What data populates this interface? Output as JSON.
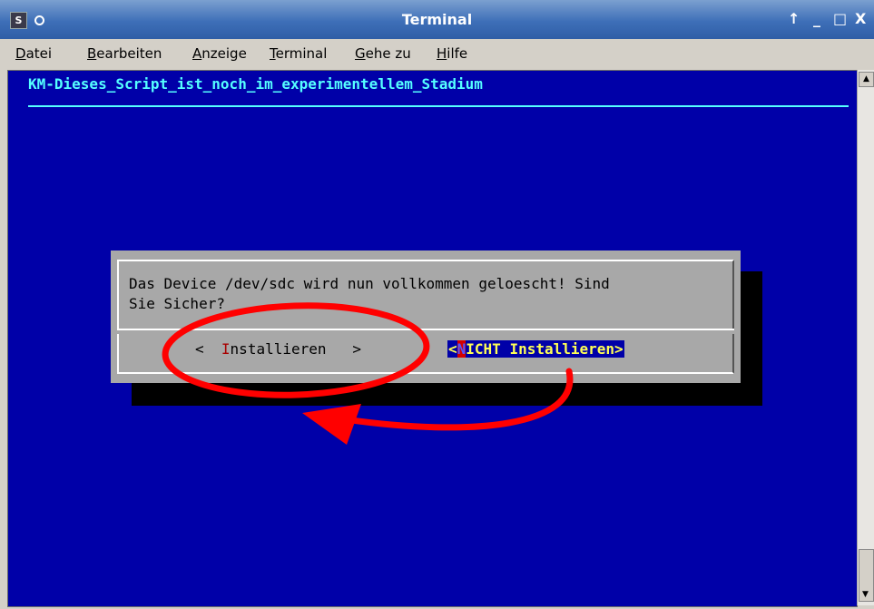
{
  "window": {
    "title": "Terminal",
    "app_icon": "S",
    "controls": {
      "up": "↑",
      "minimize": "_",
      "maximize": "□",
      "close": "X"
    }
  },
  "menu": [
    {
      "hotkey": "D",
      "rest": "atei"
    },
    {
      "hotkey": "B",
      "rest": "earbeiten"
    },
    {
      "hotkey": "A",
      "rest": "nzeige"
    },
    {
      "hotkey": "T",
      "rest": "erminal"
    },
    {
      "hotkey": "G",
      "rest": "ehe zu"
    },
    {
      "hotkey": "H",
      "rest": "ilfe"
    }
  ],
  "terminal": {
    "heading": "KM-Dieses_Script_ist_noch_im_experimentellem_Stadium",
    "colors": {
      "background": "#0000a8",
      "heading": "#55ffff"
    }
  },
  "dialog": {
    "message_line1": "Das Device /dev/sdc wird nun vollkommen geloescht! Sind",
    "message_line2": "Sie Sicher?",
    "yes_button": {
      "left": "<  ",
      "hotkey": "I",
      "rest": "nstallieren",
      "right": "   >"
    },
    "no_button": {
      "left": "<",
      "hotkey": "N",
      "rest": "ICHT Installieren>"
    }
  },
  "annotation": {
    "color": "#ff0000"
  }
}
